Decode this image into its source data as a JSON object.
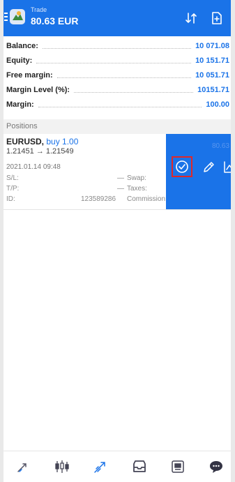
{
  "header": {
    "section": "Trade",
    "amount": "80.63 EUR"
  },
  "summary": [
    {
      "label": "Balance:",
      "value": "10 071.08"
    },
    {
      "label": "Equity:",
      "value": "10 151.71"
    },
    {
      "label": "Free margin:",
      "value": "10 051.71"
    },
    {
      "label": "Margin Level (%):",
      "value": "10151.71"
    },
    {
      "label": "Margin:",
      "value": "100.00"
    }
  ],
  "positions_header": "Positions",
  "position": {
    "symbol": "EURUSD,",
    "direction": "buy 1.00",
    "price": "1.21451 → 1.21549",
    "date": "2021.01.14 09:48",
    "sl_label": "S/L:",
    "sl_value": "—",
    "tp_label": "T/P:",
    "tp_value": "—",
    "id_label": "ID:",
    "id_value": "123589286",
    "swap_label": "Swap:",
    "taxes_label": "Taxes:",
    "commission_label": "Commission:",
    "profit": "80.63"
  },
  "swipe_actions": [
    {
      "icon": "check-circle-icon"
    },
    {
      "icon": "pencil-icon"
    },
    {
      "icon": "line-chart-icon"
    }
  ],
  "bottom_nav": [
    {
      "icon": "quotes-icon"
    },
    {
      "icon": "candlestick-chart-icon"
    },
    {
      "icon": "trade-icon"
    },
    {
      "icon": "inbox-icon"
    },
    {
      "icon": "news-icon"
    },
    {
      "icon": "chat-icon"
    }
  ],
  "colors": {
    "accent": "#1a73e8",
    "highlight": "#e02828"
  }
}
